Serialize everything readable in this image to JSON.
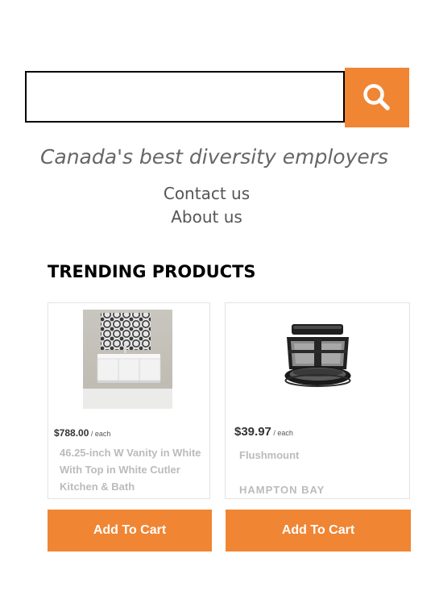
{
  "search": {
    "value": "",
    "placeholder": ""
  },
  "tagline": "Canada's best diversity employers",
  "nav": {
    "contact": "Contact us",
    "about": "About us"
  },
  "section_title": "TRENDING PRODUCTS",
  "products": [
    {
      "price": "$788.00",
      "unit": " / each",
      "name": "46.25-inch W Vanity in White With Top in White Cutler Kitchen & Bath",
      "brand": "",
      "add_to_cart": "Add To Cart"
    },
    {
      "price": "$39.97",
      "unit": " / each",
      "name": "Flushmount",
      "brand": "HAMPTON BAY",
      "add_to_cart": "Add To Cart"
    }
  ],
  "colors": {
    "accent": "#f08533",
    "text_muted": "#bbbbbb"
  }
}
